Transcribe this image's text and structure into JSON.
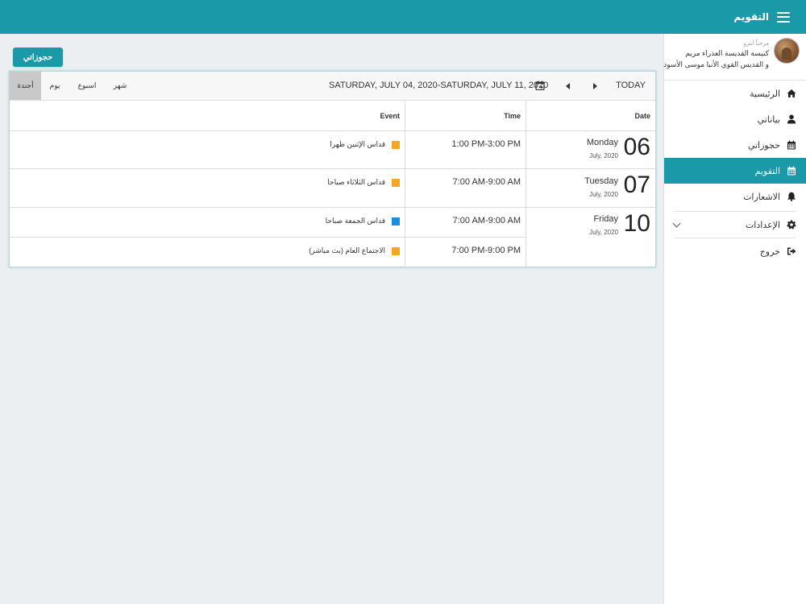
{
  "header": {
    "title": "التقويم"
  },
  "sidebar": {
    "welcome": "مرحباً أنترو",
    "church_line1": "كنيسة القديسة العذراء مريم",
    "church_line2": "و القديس القوي الأنبا موسى الأسود",
    "items": [
      {
        "label": "الرئيسية",
        "icon": "home-icon"
      },
      {
        "label": "بياناتي",
        "icon": "user-icon"
      },
      {
        "label": "حجوزاتي",
        "icon": "calendar-icon"
      },
      {
        "label": "التقويم",
        "icon": "calendar-icon",
        "active": true
      },
      {
        "label": "الاشعارات",
        "icon": "bell-icon"
      },
      {
        "label": "الإعدادات",
        "icon": "gear-icon"
      },
      {
        "label": "خروج",
        "icon": "sign-out-icon"
      }
    ]
  },
  "main": {
    "my_reservations_label": "حجوزاتي"
  },
  "calendar": {
    "today_label": "TODAY",
    "range_text": "SATURDAY, JULY 04, 2020-SATURDAY, JULY 11, 2020",
    "views": {
      "month": "شهر",
      "week": "اسبوع",
      "day": "يوم",
      "agenda": "أجندة"
    },
    "active_view": "agenda",
    "headers": {
      "date": "Date",
      "time": "Time",
      "event": "Event"
    },
    "days": [
      {
        "num": "06",
        "name": "Monday",
        "month": "July, 2020"
      },
      {
        "num": "07",
        "name": "Tuesday",
        "month": "July, 2020"
      },
      {
        "num": "10",
        "name": "Friday",
        "month": "July, 2020"
      }
    ],
    "events": [
      {
        "time": "1:00 PM-3:00 PM",
        "title": "قداس الإثنين ظهرا",
        "color": "#f5a623"
      },
      {
        "time": "7:00 AM-9:00 AM",
        "title": "قداس الثلاثاء صباحا",
        "color": "#f5a623"
      },
      {
        "time": "7:00 AM-9:00 AM",
        "title": "قداس الجمعة صباحا",
        "color": "#1a8fe0"
      },
      {
        "time": "7:00 PM-9:00 PM",
        "title": "الاجتماع العام (بث مباشر)",
        "color": "#f5a623"
      }
    ]
  }
}
